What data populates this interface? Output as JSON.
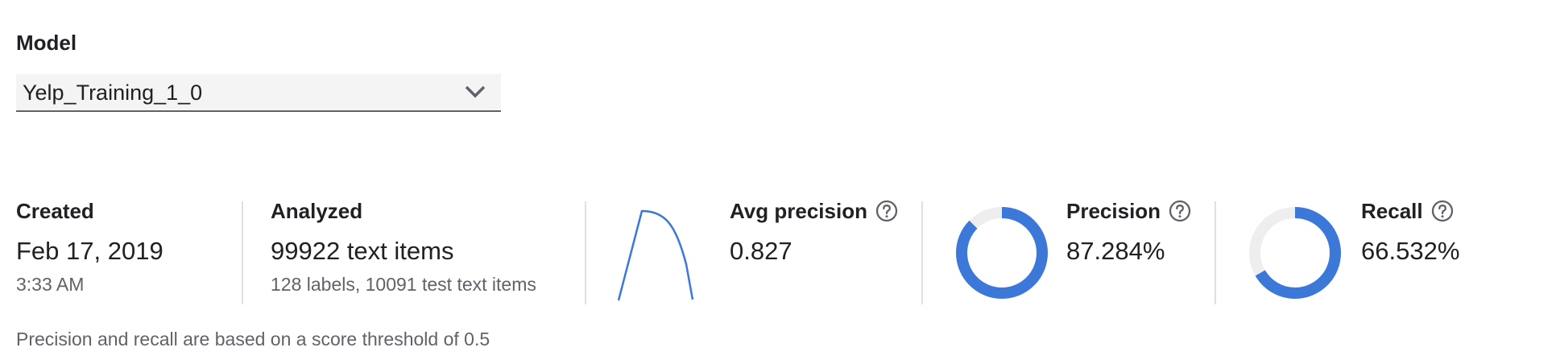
{
  "model": {
    "label": "Model",
    "selected": "Yelp_Training_1_0",
    "dropdown_icon": "chevron-down-icon"
  },
  "created": {
    "title": "Created",
    "date": "Feb 17, 2019",
    "time": "3:33 AM"
  },
  "analyzed": {
    "title": "Analyzed",
    "items": "99922 text items",
    "details": "128 labels, 10091 test text items"
  },
  "avg_precision": {
    "title": "Avg precision",
    "value": "0.827",
    "help_icon": "help-circle-icon",
    "curve_icon": "precision-recall-curve"
  },
  "precision": {
    "title": "Precision",
    "value": "87.284%",
    "fraction": 0.87284,
    "help_icon": "help-circle-icon"
  },
  "recall": {
    "title": "Recall",
    "value": "66.532%",
    "fraction": 0.66532,
    "help_icon": "help-circle-icon"
  },
  "footer": {
    "note": "Precision and recall are based on a score threshold of 0.5"
  },
  "colors": {
    "accent": "#3c78d8",
    "track": "#eeeeee",
    "divider": "#e0e0e0",
    "text_primary": "#202124",
    "text_secondary": "#5f6368",
    "select_bg": "#f4f4f4"
  }
}
